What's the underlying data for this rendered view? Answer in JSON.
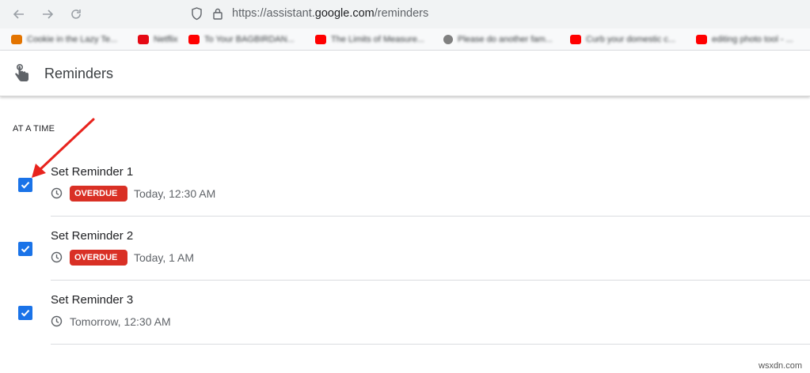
{
  "browser": {
    "url_prefix": "https://assistant.",
    "url_host": "google.com",
    "url_path": "/reminders",
    "bookmarks": [
      {
        "label": "Cookie in the Lazy Te...",
        "icon": "bookmark-favicon",
        "color": "#e37400"
      },
      {
        "label": "Netflix",
        "icon": "netflix-favicon",
        "color": "#e50914"
      },
      {
        "label": "To Your BAGBIRDAN...",
        "icon": "youtube-favicon",
        "color": "#ff0000"
      },
      {
        "label": "The Limits of Measure...",
        "icon": "youtube-favicon",
        "color": "#ff0000"
      },
      {
        "label": "Please do another fam...",
        "icon": "globe-favicon",
        "color": "#808080"
      },
      {
        "label": "Curb your domestic c...",
        "icon": "youtube-favicon",
        "color": "#ff0000"
      },
      {
        "label": "editing photo tool - ...",
        "icon": "youtube-favicon",
        "color": "#ff0000"
      }
    ]
  },
  "app": {
    "title": "Reminders"
  },
  "section": {
    "label": "AT A TIME"
  },
  "reminders": [
    {
      "title": "Set Reminder 1",
      "badge": "OVERDUE",
      "time": "Today, 12:30 AM",
      "checked": true
    },
    {
      "title": "Set Reminder 2",
      "badge": "OVERDUE",
      "time": "Today, 1 AM",
      "checked": true
    },
    {
      "title": "Set Reminder 3",
      "badge": "",
      "time": "Tomorrow, 12:30 AM",
      "checked": true
    }
  ],
  "watermark": "wsxdn.com",
  "colors": {
    "accent": "#1a73e8",
    "overdue": "#d93025",
    "annotation_arrow": "#e8231d"
  }
}
